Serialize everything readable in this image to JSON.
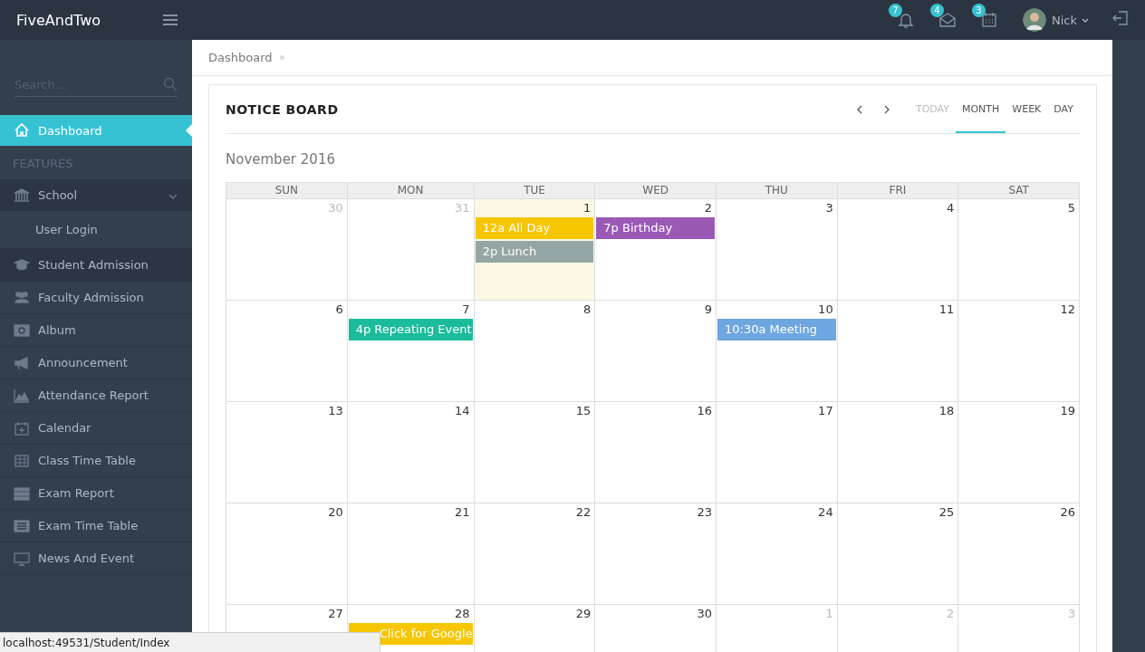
{
  "topbar": {
    "brand": "FiveAndTwo",
    "notifications": [
      {
        "kind": "bell",
        "count": "7"
      },
      {
        "kind": "mail",
        "count": "4"
      },
      {
        "kind": "calendar",
        "count": "3"
      }
    ],
    "user": {
      "name": "Nick"
    }
  },
  "sidebar": {
    "search": {
      "placeholder": "Search..."
    },
    "items": [
      {
        "kind": "link",
        "label": "Dashboard",
        "selected": true,
        "hovered": false
      },
      {
        "kind": "heading",
        "label": "FEATURES"
      },
      {
        "kind": "group",
        "label": "School",
        "expanded": true,
        "children": [
          {
            "label": "User Login"
          }
        ]
      },
      {
        "kind": "link",
        "label": "Student Admission",
        "selected": false,
        "hovered": true
      },
      {
        "kind": "link",
        "label": "Faculty Admission",
        "selected": false,
        "hovered": false
      },
      {
        "kind": "link",
        "label": "Album",
        "selected": false,
        "hovered": false
      },
      {
        "kind": "link",
        "label": "Announcement",
        "selected": false,
        "hovered": false
      },
      {
        "kind": "link",
        "label": "Attendance Report",
        "selected": false,
        "hovered": false
      },
      {
        "kind": "link",
        "label": "Calendar",
        "selected": false,
        "hovered": false
      },
      {
        "kind": "link",
        "label": "Class Time Table",
        "selected": false,
        "hovered": false
      },
      {
        "kind": "link",
        "label": "Exam Report",
        "selected": false,
        "hovered": false
      },
      {
        "kind": "link",
        "label": "Exam Time Table",
        "selected": false,
        "hovered": false
      },
      {
        "kind": "link",
        "label": "News And Event",
        "selected": false,
        "hovered": false
      }
    ]
  },
  "breadcrumb": [
    "Dashboard"
  ],
  "notice_board": {
    "title": "NOTICE BOARD",
    "views": [
      {
        "label": "TODAY",
        "selected": false,
        "disabled": true
      },
      {
        "label": "MONTH",
        "selected": true,
        "disabled": false
      },
      {
        "label": "WEEK",
        "selected": false,
        "disabled": false
      },
      {
        "label": "DAY",
        "selected": false,
        "disabled": false
      }
    ],
    "calendar": {
      "title": "November 2016",
      "weekdays": [
        "SUN",
        "MON",
        "TUE",
        "WED",
        "THU",
        "FRI",
        "SAT"
      ],
      "weeks": [
        [
          {
            "day": "30",
            "other_month": true,
            "today": false
          },
          {
            "day": "31",
            "other_month": true,
            "today": false
          },
          {
            "day": "1",
            "other_month": false,
            "today": true,
            "events": [
              {
                "text": "12a All Day",
                "color": "#f6c600"
              },
              {
                "text": "2p Lunch",
                "color": "#95a5a6"
              }
            ]
          },
          {
            "day": "2",
            "other_month": false,
            "today": false,
            "events": [
              {
                "text": "7p Birthday",
                "color": "#9b59b6"
              }
            ]
          },
          {
            "day": "3",
            "other_month": false,
            "today": false
          },
          {
            "day": "4",
            "other_month": false,
            "today": false
          },
          {
            "day": "5",
            "other_month": false,
            "today": false
          }
        ],
        [
          {
            "day": "6",
            "other_month": false,
            "today": false
          },
          {
            "day": "7",
            "other_month": false,
            "today": false,
            "events": [
              {
                "text": "4p Repeating Event",
                "color": "#1abc9c"
              }
            ]
          },
          {
            "day": "8",
            "other_month": false,
            "today": false
          },
          {
            "day": "9",
            "other_month": false,
            "today": false
          },
          {
            "day": "10",
            "other_month": false,
            "today": false,
            "events": [
              {
                "text": "10:30a Meeting",
                "color": "#6ea6e0"
              }
            ]
          },
          {
            "day": "11",
            "other_month": false,
            "today": false
          },
          {
            "day": "12",
            "other_month": false,
            "today": false
          }
        ],
        [
          {
            "day": "13",
            "other_month": false,
            "today": false
          },
          {
            "day": "14",
            "other_month": false,
            "today": false
          },
          {
            "day": "15",
            "other_month": false,
            "today": false
          },
          {
            "day": "16",
            "other_month": false,
            "today": false
          },
          {
            "day": "17",
            "other_month": false,
            "today": false
          },
          {
            "day": "18",
            "other_month": false,
            "today": false
          },
          {
            "day": "19",
            "other_month": false,
            "today": false
          }
        ],
        [
          {
            "day": "20",
            "other_month": false,
            "today": false
          },
          {
            "day": "21",
            "other_month": false,
            "today": false
          },
          {
            "day": "22",
            "other_month": false,
            "today": false
          },
          {
            "day": "23",
            "other_month": false,
            "today": false
          },
          {
            "day": "24",
            "other_month": false,
            "today": false
          },
          {
            "day": "25",
            "other_month": false,
            "today": false
          },
          {
            "day": "26",
            "other_month": false,
            "today": false
          }
        ],
        [
          {
            "day": "27",
            "other_month": false,
            "today": false
          },
          {
            "day": "28",
            "other_month": false,
            "today": false,
            "events": [
              {
                "text": "Click for Google",
                "color": "#f6c600"
              }
            ]
          },
          {
            "day": "29",
            "other_month": false,
            "today": false
          },
          {
            "day": "30",
            "other_month": false,
            "today": false
          },
          {
            "day": "1",
            "other_month": true,
            "today": false
          },
          {
            "day": "2",
            "other_month": true,
            "today": false
          },
          {
            "day": "3",
            "other_month": true,
            "today": false
          }
        ]
      ]
    }
  },
  "status_bar": {
    "url": "localhost:49531/Student/Index"
  }
}
